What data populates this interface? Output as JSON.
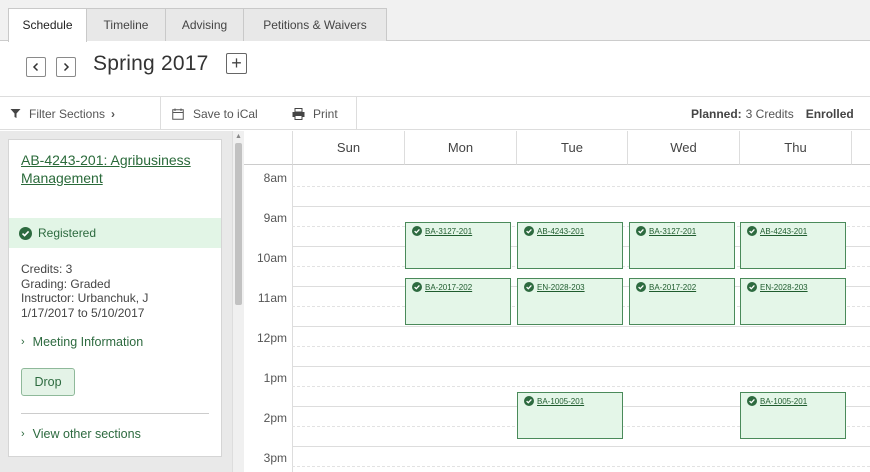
{
  "tabs": [
    {
      "label": "Schedule",
      "active": true
    },
    {
      "label": "Timeline",
      "active": false
    },
    {
      "label": "Advising",
      "active": false
    },
    {
      "label": "Petitions & Waivers",
      "active": false
    }
  ],
  "term": {
    "title": "Spring 2017",
    "add": "+"
  },
  "toolbar": {
    "filter": "Filter Sections",
    "filter_chev": "›",
    "ical": "Save to iCal",
    "print": "Print",
    "planned_label": "Planned:",
    "planned_value": "3 Credits",
    "enrolled_label": "Enrolled"
  },
  "course": {
    "title": "AB-4243-201: Agribusiness Management",
    "status": "Registered",
    "credits": "Credits: 3",
    "grading": "Grading: Graded",
    "instructor": "Instructor: Urbanchuk, J",
    "dates": "1/17/2017 to 5/10/2017",
    "meeting_info": "Meeting Information",
    "drop": "Drop",
    "other_sections": "View other sections"
  },
  "calendar": {
    "days": [
      "Sun",
      "Mon",
      "Tue",
      "Wed",
      "Thu"
    ],
    "times": [
      "8am",
      "9am",
      "10am",
      "11am",
      "12pm",
      "1pm",
      "2pm",
      "3pm"
    ],
    "events": {
      "mon_930": "BA-3127-201",
      "tue_930": "AB-4243-201",
      "wed_930": "BA-3127-201",
      "thu_930": "AB-4243-201",
      "mon_1100": "BA-2017-202",
      "tue_1100": "EN-2028-203",
      "wed_1100": "BA-2017-202",
      "thu_1100": "EN-2028-203",
      "tue_200": "BA-1005-201",
      "thu_200": "BA-1005-201"
    }
  },
  "colors": {
    "accent": "#2d6a3f",
    "event_fill": "#e4f6e8",
    "event_border": "#4a8a5a",
    "registered_bg": "#e2f5e6"
  }
}
